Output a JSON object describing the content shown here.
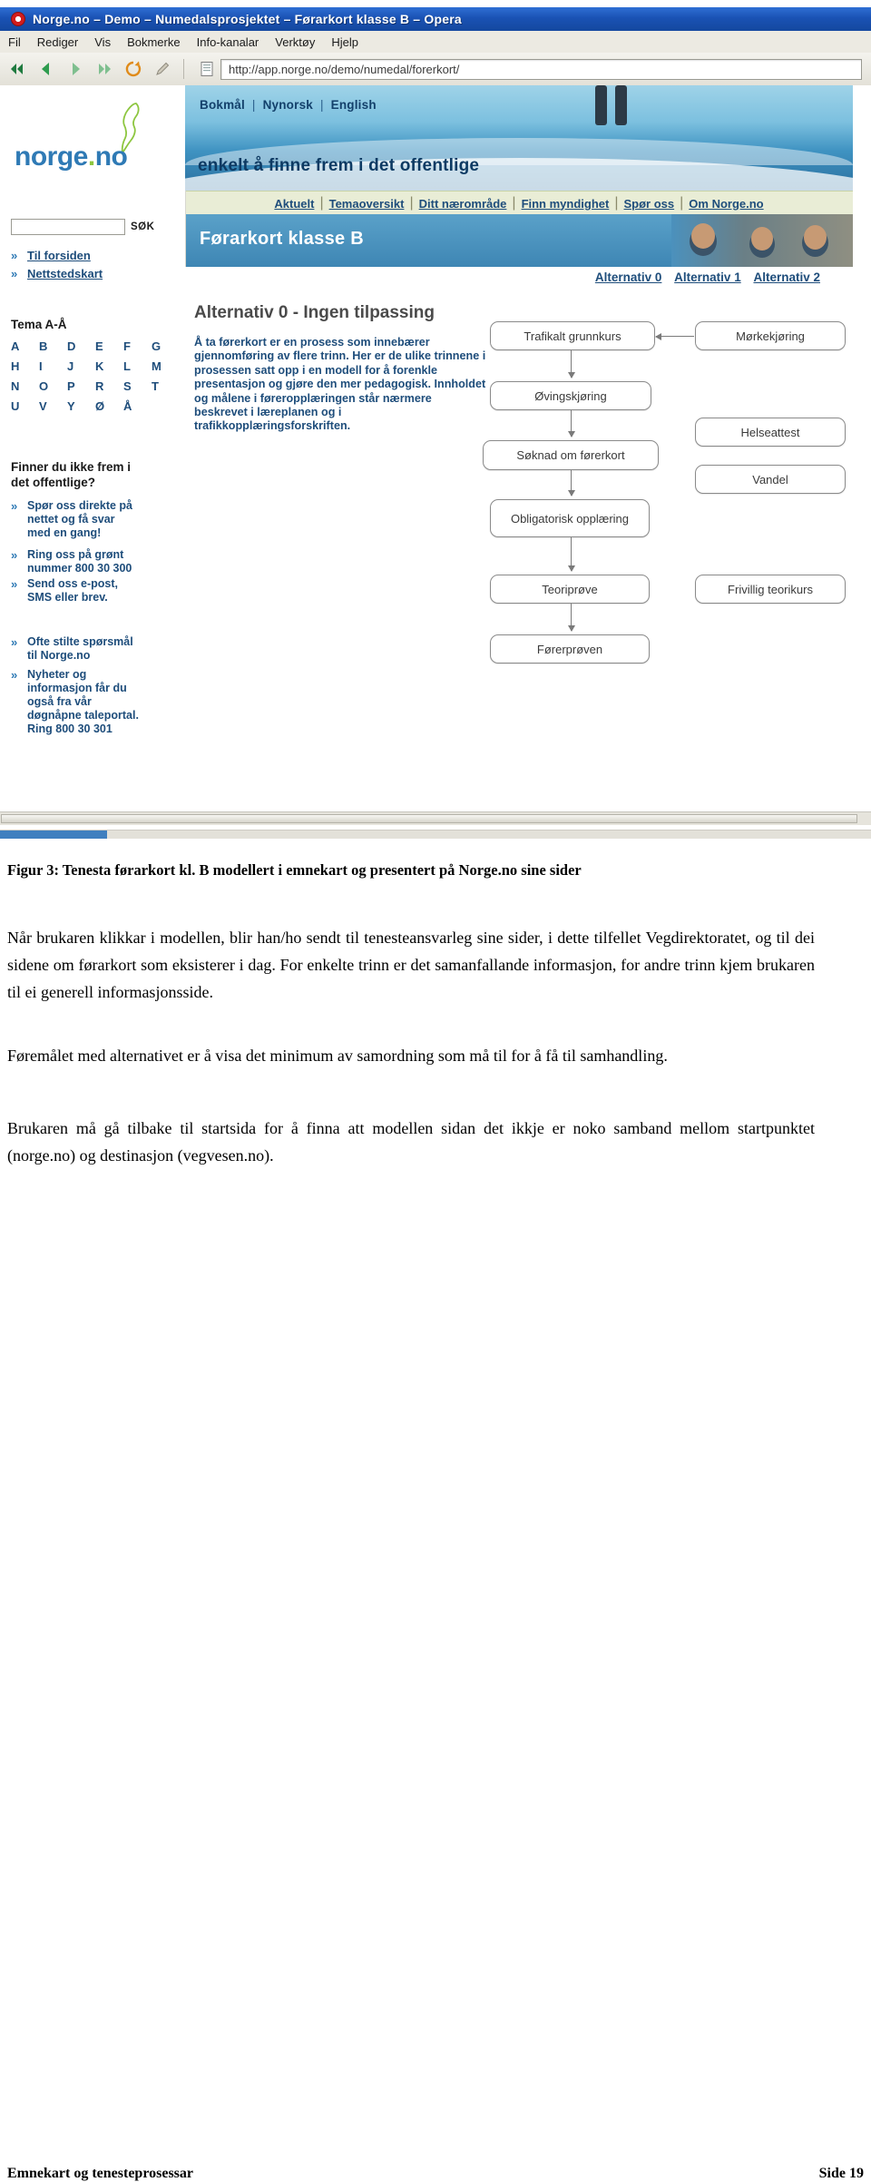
{
  "window": {
    "title": "Norge.no – Demo – Numedalsprosjektet – Førarkort klasse B – Opera",
    "app_icon": "opera-logo-icon"
  },
  "menubar": [
    {
      "label": "Fil"
    },
    {
      "label": "Rediger"
    },
    {
      "label": "Vis"
    },
    {
      "label": "Bokmerke"
    },
    {
      "label": "Info-kanalar"
    },
    {
      "label": "Verktøy"
    },
    {
      "label": "Hjelp"
    }
  ],
  "toolbar": {
    "buttons": [
      {
        "name": "rewind-icon",
        "glyph": "«"
      },
      {
        "name": "back-icon",
        "glyph": "◀"
      },
      {
        "name": "forward-icon",
        "glyph": "▶"
      },
      {
        "name": "fast-forward-icon",
        "glyph": "»"
      },
      {
        "name": "reload-icon",
        "glyph": "⟳"
      },
      {
        "name": "edit-icon",
        "glyph": "✎"
      },
      {
        "name": "page-icon",
        "glyph": "▤"
      }
    ],
    "url": "http://app.norge.no/demo/numedal/forerkort/"
  },
  "page": {
    "languages": [
      "Bokmål",
      "Nynorsk",
      "English"
    ],
    "logo": {
      "text": "norge",
      "dot": ".",
      "suffix": "no"
    },
    "slogan": "enkelt å finne frem i det offentlige",
    "nav": [
      "Aktuelt",
      "Temaoversikt",
      "Ditt nærområde",
      "Finn myndighet",
      "Spør oss",
      "Om Norge.no"
    ],
    "page_title": "Førarkort klasse B",
    "sidebar": {
      "search_placeholder": "",
      "search_value": "",
      "search_button": "SØK",
      "links": [
        "Til forsiden",
        "Nettstedskart"
      ],
      "theme_heading": "Tema A-Å",
      "alphabet": [
        "A",
        "B",
        "D",
        "E",
        "F",
        "G",
        "H",
        "I",
        "J",
        "K",
        "L",
        "M",
        "N",
        "O",
        "P",
        "R",
        "S",
        "T",
        "U",
        "V",
        "Y",
        "Ø",
        "Å"
      ],
      "help_heading": "Finner du ikke frem i\ndet offentlige?",
      "help_items": [
        "Spør oss direkte på\nnettet og få svar\nmed en gang!",
        "Ring oss på grønt\nnummer 800 30 300",
        "Send oss e-post,\nSMS eller brev."
      ],
      "extra_items": [
        "Ofte stilte spørsmål\ntil Norge.no",
        "Nyheter og\ninformasjon får du\nogså fra vår\ndøgnåpne taleportal.\nRing 800 30 301"
      ]
    },
    "alternatives": [
      "Alternativ 0",
      "Alternativ 1",
      "Alternativ 2"
    ],
    "alt_heading": "Alternativ 0 - Ingen tilpassing",
    "alt_body": "Å ta førerkort er en prosess som innebærer gjennomføring av flere trinn. Her er de ulike trinnene i prosessen satt opp i en modell for å forenkle presentasjon og gjøre den mer pedagogisk. Innholdet og målene i føreropplæringen står nærmere beskrevet i læreplanen og i trafikkopplæringsforskriften.",
    "diagram": {
      "nodes": [
        {
          "id": "trafikalt",
          "label": "Trafikalt grunnkurs"
        },
        {
          "id": "morkekjoring",
          "label": "Mørkekjøring"
        },
        {
          "id": "ovingskjoring",
          "label": "Øvingskjøring"
        },
        {
          "id": "helseattest",
          "label": "Helseattest"
        },
        {
          "id": "soknad",
          "label": "Søknad om førerkort"
        },
        {
          "id": "vandel",
          "label": "Vandel"
        },
        {
          "id": "obligatorisk",
          "label": "Obligatorisk opplæring"
        },
        {
          "id": "teoriprove",
          "label": "Teoriprøve"
        },
        {
          "id": "frivillig",
          "label": "Frivillig teorikurs"
        },
        {
          "id": "forerproven",
          "label": "Førerprøven"
        }
      ]
    }
  },
  "document": {
    "caption": "Figur 3: Tenesta førarkort kl. B modellert i emnekart og presentert på Norge.no sine sider",
    "paragraphs": [
      "Når brukaren klikkar i modellen, blir han/ho sendt til tenesteansvarleg sine sider, i dette tilfellet Vegdirektoratet, og til dei sidene om førarkort som eksisterer i dag. For enkelte trinn er det samanfallande informasjon, for andre trinn kjem brukaren til ei generell informasjonsside.",
      "Føremålet med alternativet er å visa det minimum av samordning som må til for å få til samhandling.",
      "Brukaren må gå tilbake til startsida for å finna att modellen sidan det ikkje er noko samband mellom startpunktet (norge.no) og destinasjon (vegvesen.no)."
    ],
    "footer_left": "Emnekart og tenesteprosessar",
    "footer_right": "Side 19"
  }
}
